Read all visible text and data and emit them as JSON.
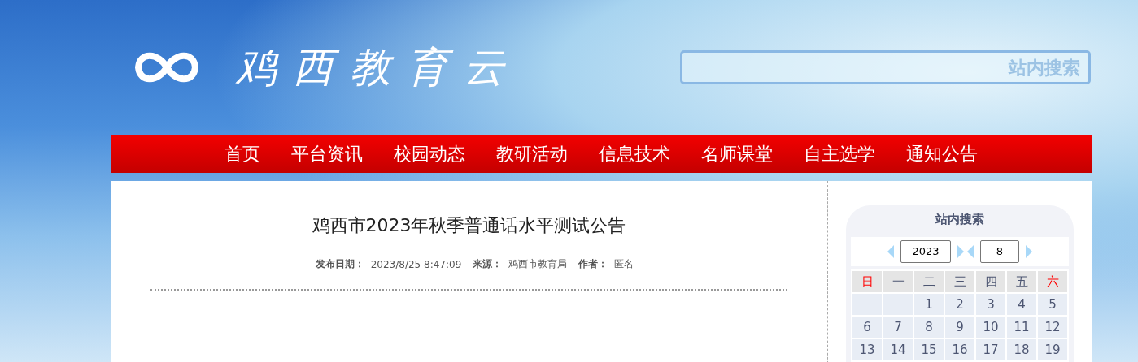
{
  "header": {
    "site_title": "鸡西教育云",
    "search": {
      "placeholder": "站内搜索"
    }
  },
  "nav": [
    {
      "label": "首页"
    },
    {
      "label": "平台资讯"
    },
    {
      "label": "校园动态"
    },
    {
      "label": "教研活动"
    },
    {
      "label": "信息技术"
    },
    {
      "label": "名师课堂"
    },
    {
      "label": "自主选学"
    },
    {
      "label": "通知公告"
    }
  ],
  "article": {
    "title": "鸡西市2023年秋季普通话水平测试公告",
    "meta": [
      {
        "label": "发布日期：",
        "value": "2023/8/25 8:47:09"
      },
      {
        "label": "来源：",
        "value": "鸡西市教育局"
      },
      {
        "label": "作者：",
        "value": "匿名"
      }
    ]
  },
  "sidebar": {
    "title": "站内搜索",
    "calendar": {
      "year": "2023",
      "month": "8",
      "weekdays": [
        {
          "label": "日",
          "weekend": true
        },
        {
          "label": "一",
          "weekend": false
        },
        {
          "label": "二",
          "weekend": false
        },
        {
          "label": "三",
          "weekend": false
        },
        {
          "label": "四",
          "weekend": false
        },
        {
          "label": "五",
          "weekend": false
        },
        {
          "label": "六",
          "weekend": true
        }
      ],
      "weeks": [
        [
          "1",
          "2",
          "3",
          "4",
          "5"
        ],
        [
          "6",
          "7",
          "8",
          "9",
          "10",
          "11",
          "12"
        ],
        [
          "13",
          "14",
          "15",
          "16",
          "17",
          "18",
          "19"
        ]
      ]
    }
  }
}
